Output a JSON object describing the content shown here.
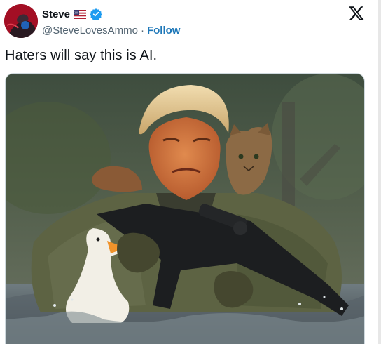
{
  "author": {
    "display_name": "Steve",
    "handle": "@SteveLovesAmmo",
    "separator": "·",
    "follow_label": "Follow",
    "flag_icon": "us-flag-icon",
    "verified_icon": "verified-badge-icon"
  },
  "tweet": {
    "text": "Haters will say this is AI."
  },
  "brand": {
    "logo_icon": "x-logo-icon"
  },
  "colors": {
    "text": "#0f1419",
    "secondary": "#536471",
    "follow": "#1d77b8",
    "verified": "#1d9bf0"
  }
}
